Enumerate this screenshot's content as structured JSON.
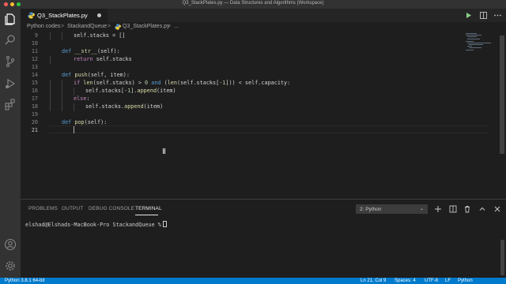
{
  "window": {
    "title": "Q3_StackPlates.py — Data Structures and Algorithms (Workspace)"
  },
  "tab": {
    "label": "Q3_StackPlates.py"
  },
  "breadcrumbs": {
    "folder1": "Python codes",
    "sep": ">",
    "folder2": "StackandQueue",
    "file": "Q3_StackPlates.py",
    "sep2": ">",
    "more": "..."
  },
  "editor": {
    "line_numbers": [
      "9",
      "10",
      "11",
      "12",
      "13",
      "14",
      "15",
      "16",
      "17",
      "18",
      "19",
      "20",
      "21"
    ],
    "active_line": "21",
    "code": {
      "l9_text": "self.stacks = []",
      "l11_def": "def",
      "l11_name": "__str__",
      "l11_rest": "(self):",
      "l12_ret": "return",
      "l12_rest": "self.stacks",
      "l14_def": "def",
      "l14_name": "push",
      "l14_rest": "(self, item):",
      "l15_if": "if",
      "l15_len": "len",
      "l15_a": "(self.stacks) >",
      "l15_zero": "0",
      "l15_and": "and",
      "l15_b": "(",
      "l15_len2": "len",
      "l15_c": "(self.stacks[",
      "l15_neg1": "-1",
      "l15_d": "])) < self.capacity:",
      "l16_a": "self.stacks[",
      "l16_neg1": "-1",
      "l16_b": "].",
      "l16_fn": "append",
      "l16_c": "(item)",
      "l17_else": "else",
      "l17_colon": ":",
      "l18_a": "self.stacks.",
      "l18_fn": "append",
      "l18_b": "(item)",
      "l20_def": "def",
      "l20_name": "pop",
      "l20_rest": "(self):"
    }
  },
  "panel": {
    "tabs": [
      "PROBLEMS",
      "OUTPUT",
      "DEBUG CONSOLE",
      "TERMINAL"
    ],
    "active_tab": "TERMINAL",
    "terminal_select": "2: Python",
    "terminal_prompt": "elshad@Elshads-MacBook-Pro StackandQueue %"
  },
  "statusbar": {
    "interpreter": "Python 3.8.1 64-bit",
    "position": "Ln 21, Col 9",
    "spaces": "Spaces: 4",
    "encoding": "UTF-8",
    "eol": "LF",
    "language": "Python"
  },
  "colors": {
    "accent": "#007acc",
    "keyword": "#569cd6",
    "control": "#c586c0",
    "function": "#dcdcaa",
    "number": "#b5cea8",
    "variable": "#9cdcfe"
  },
  "icons": [
    "files-icon",
    "search-icon",
    "source-control-icon",
    "run-debug-icon",
    "extensions-icon",
    "account-icon",
    "settings-gear-icon",
    "python-file-icon",
    "run-icon",
    "split-editor-icon",
    "more-icon",
    "add-terminal-icon",
    "split-terminal-icon",
    "trash-icon",
    "maximize-panel-icon",
    "close-panel-icon"
  ]
}
